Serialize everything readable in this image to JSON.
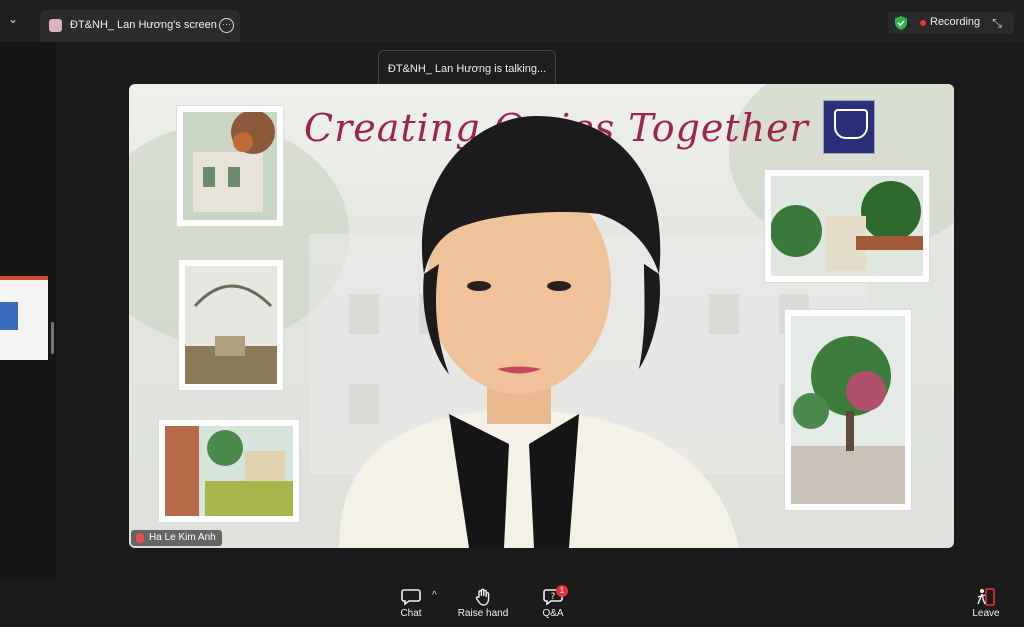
{
  "window": {
    "tab_title": "ĐT&NH_ Lan Hương's screen",
    "more_icon": "ellipsis-icon",
    "recording_label": "Recording"
  },
  "toast": {
    "text": "ĐT&NH_ Lan Hương is talking..."
  },
  "video": {
    "headline": "Creating Or        ies Together",
    "participant_name": "Ha Le Kim Anh"
  },
  "toolbar": {
    "chat_label": "Chat",
    "raise_hand_label": "Raise hand",
    "qa_label": "Q&A",
    "qa_badge": "1",
    "leave_label": "Leave"
  },
  "colors": {
    "headline": "#9b2648",
    "recording_dot": "#e03a3a",
    "shield": "#2db34a",
    "badge": "#e0343a",
    "leave_icon": "#e0343a"
  }
}
